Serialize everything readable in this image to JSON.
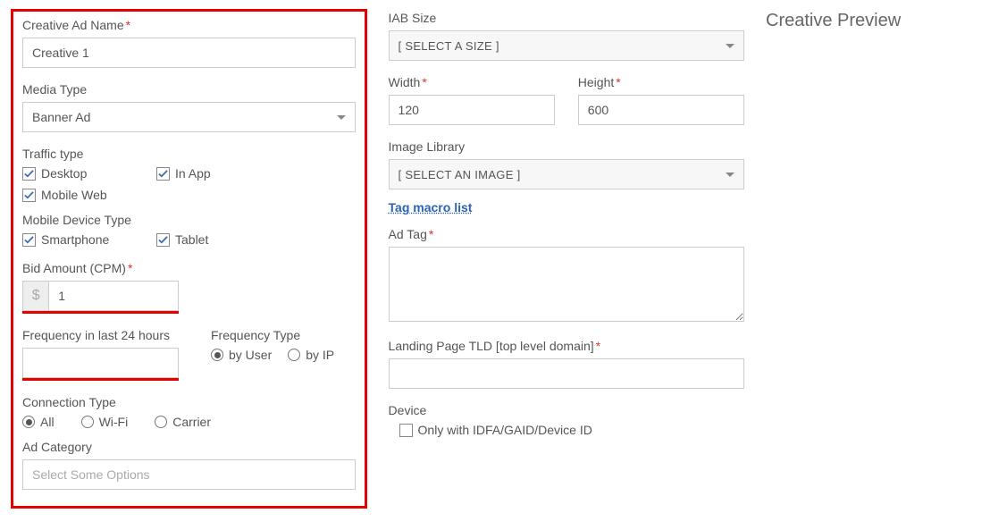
{
  "col1": {
    "creativeName": {
      "label": "Creative Ad Name",
      "value": "Creative 1"
    },
    "mediaType": {
      "label": "Media Type",
      "value": "Banner Ad"
    },
    "trafficType": {
      "label": "Traffic type",
      "options": [
        {
          "label": "Desktop",
          "checked": true
        },
        {
          "label": "In App",
          "checked": true
        },
        {
          "label": "Mobile Web",
          "checked": true
        }
      ]
    },
    "mobileDeviceType": {
      "label": "Mobile Device Type",
      "options": [
        {
          "label": "Smartphone",
          "checked": true
        },
        {
          "label": "Tablet",
          "checked": true
        }
      ]
    },
    "bid": {
      "label": "Bid Amount (CPM)",
      "prefix": "$",
      "value": "1"
    },
    "frequency": {
      "label": "Frequency in last 24 hours",
      "value": ""
    },
    "frequencyType": {
      "label": "Frequency Type",
      "options": [
        {
          "label": "by User",
          "checked": true
        },
        {
          "label": "by IP",
          "checked": false
        }
      ]
    },
    "connectionType": {
      "label": "Connection Type",
      "options": [
        {
          "label": "All",
          "checked": true
        },
        {
          "label": "Wi-Fi",
          "checked": false
        },
        {
          "label": "Carrier",
          "checked": false
        }
      ]
    },
    "adCategory": {
      "label": "Ad Category",
      "placeholder": "Select Some Options"
    }
  },
  "col2": {
    "iabSize": {
      "label": "IAB Size",
      "value": "[ SELECT A SIZE ]"
    },
    "width": {
      "label": "Width",
      "value": "120"
    },
    "height": {
      "label": "Height",
      "value": "600"
    },
    "imageLibrary": {
      "label": "Image Library",
      "value": "[ SELECT AN IMAGE ]"
    },
    "tagMacroLink": "Tag macro list",
    "adTag": {
      "label": "Ad Tag",
      "value": ""
    },
    "landingTld": {
      "label": "Landing Page TLD [top level domain]",
      "value": ""
    },
    "device": {
      "label": "Device",
      "option": {
        "label": "Only with IDFA/GAID/Device ID",
        "checked": false
      }
    }
  },
  "col3": {
    "previewTitle": "Creative Preview"
  }
}
